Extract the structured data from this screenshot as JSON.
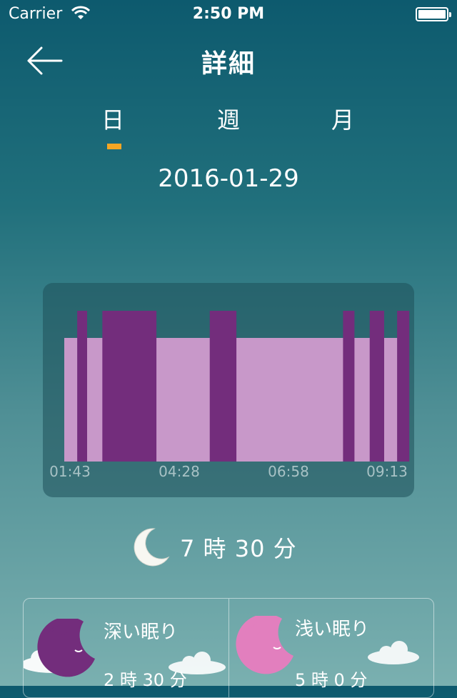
{
  "status_bar": {
    "carrier": "Carrier",
    "time": "2:50 PM"
  },
  "header": {
    "title": "詳細",
    "back_icon": "arrow-left-icon"
  },
  "tabs": [
    {
      "label": "日",
      "selected": true
    },
    {
      "label": "週",
      "selected": false
    },
    {
      "label": "月",
      "selected": false
    }
  ],
  "colors": {
    "accent": "#f5a623",
    "deep_sleep": "#732d7c",
    "light_sleep": "#c898c9"
  },
  "date": "2016-01-29",
  "chart_data": {
    "type": "bar",
    "x_range": [
      "01:43",
      "09:13"
    ],
    "tick_labels": [
      "01:43",
      "04:28",
      "06:58",
      "09:13"
    ],
    "series": [
      {
        "name": "浅い眠り",
        "segments": [
          [
            "01:43",
            "09:13"
          ]
        ]
      },
      {
        "name": "深い眠り",
        "segments": [
          [
            "02:00",
            "02:13"
          ],
          [
            "02:33",
            "03:44"
          ],
          [
            "04:54",
            "05:29"
          ],
          [
            "07:49",
            "08:04"
          ],
          [
            "08:24",
            "08:43"
          ],
          [
            "09:00",
            "09:16"
          ]
        ]
      }
    ]
  },
  "summary": {
    "total": "7 時 30 分",
    "deep": {
      "label": "深い眠り",
      "value": "2 時 30 分"
    },
    "light": {
      "label": "浅い眠り",
      "value": "5 時 0 分"
    }
  }
}
